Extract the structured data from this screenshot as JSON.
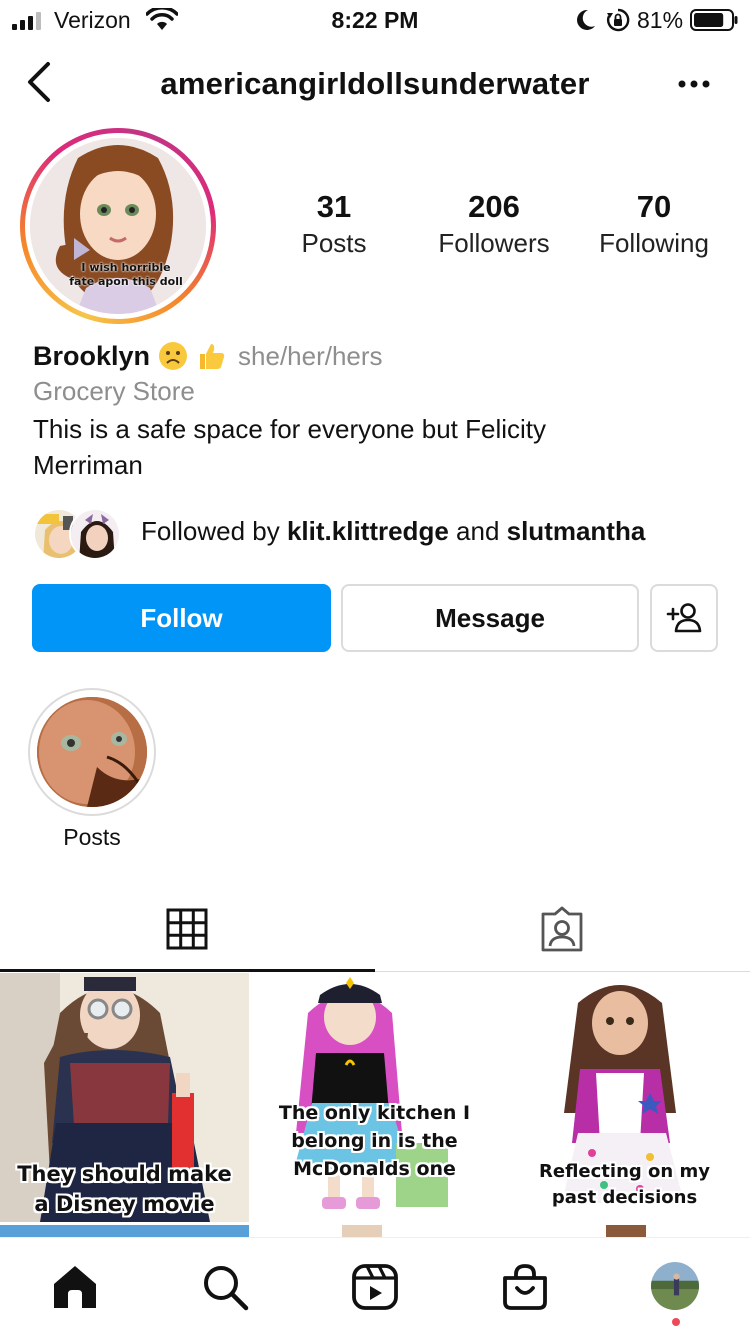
{
  "status_bar": {
    "carrier": "Verizon",
    "time": "8:22 PM",
    "battery_percent": "81%",
    "battery_level": 0.81,
    "icons": [
      "signal-icon",
      "wifi-icon",
      "moon-icon",
      "rotation-lock-icon",
      "battery-icon"
    ]
  },
  "header": {
    "username": "americangirldollsunderwater",
    "icons": [
      "back-chevron-icon",
      "more-options-icon"
    ]
  },
  "profile": {
    "avatar_caption_line1": "I wish horrible",
    "avatar_caption_line2": "fate apon this doll",
    "stats": [
      {
        "value": "31",
        "label": "Posts"
      },
      {
        "value": "206",
        "label": "Followers"
      },
      {
        "value": "70",
        "label": "Following"
      }
    ],
    "name": "Brooklyn",
    "name_emojis": [
      "frowning-face-icon",
      "thumbs-up-icon"
    ],
    "pronouns": "she/her/hers",
    "category": "Grocery Store",
    "bio": "This is a safe space for everyone but Felicity Merriman",
    "followed_by_prefix": "Followed by ",
    "followed_by_user1": "klit.klittredge",
    "followed_by_and": " and ",
    "followed_by_user2": "slutmantha"
  },
  "actions": {
    "follow_label": "Follow",
    "message_label": "Message",
    "add_icon": "add-person-icon"
  },
  "highlights": [
    {
      "label": "Posts"
    }
  ],
  "tabs": [
    {
      "icon": "grid-icon",
      "active": true
    },
    {
      "icon": "tagged-icon",
      "active": false
    }
  ],
  "posts": [
    {
      "caption_line1": "They should make",
      "caption_line2": "a Disney movie"
    },
    {
      "caption_line1": "The only kitchen I",
      "caption_line2": "belong in is the",
      "caption_line3": "McDonalds one"
    },
    {
      "caption_line1": "Reflecting on my",
      "caption_line2": "past decisions"
    }
  ],
  "bottom_nav": [
    "home-icon",
    "search-icon",
    "reels-icon",
    "shop-icon",
    "profile-avatar"
  ],
  "colors": {
    "follow_blue": "#0095f6",
    "secondary_text": "#8e8e8e",
    "border": "#dbdbdb",
    "notification_dot": "#ed4956"
  }
}
